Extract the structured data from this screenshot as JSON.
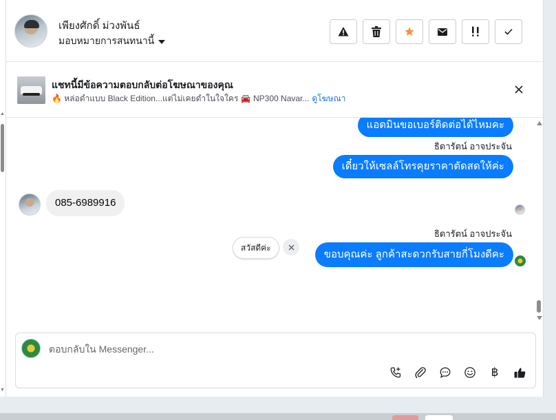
{
  "header": {
    "name": "เพียงศักดิ์ ม่วงพันธ์",
    "assign_label": "มอบหมายการสนทนานี้",
    "buttons": [
      {
        "name": "spam",
        "icon": "warning-icon"
      },
      {
        "name": "delete",
        "icon": "trash-icon"
      },
      {
        "name": "star",
        "icon": "star-icon",
        "color": "#f7923b"
      },
      {
        "name": "mark-unread",
        "icon": "envelope-icon"
      },
      {
        "name": "follow-up",
        "icon": "priority-icon"
      },
      {
        "name": "done",
        "icon": "check-icon"
      }
    ]
  },
  "ad": {
    "title": "แชทนี้มีข้อความตอบกลับต่อโฆษณาของคุณ",
    "subtitle_part1": "🔥 หล่อดำแบบ Black Edition...แต่ไม่เคยดำในใจใคร 🚘 NP300 Navar...",
    "link": "ดูโฆษณา"
  },
  "messages": {
    "out1": "แอดมินขอเบอร์ติดต่อได้ไหมคะ",
    "sender1": "ธิดารัตน์ อาจประจัน",
    "out2": "เดี๋ยวให้เซลล์โทรคุยราคาตัดสดให้ค่ะ",
    "in1": "085-6989916",
    "sender2": "ธิดารัตน์ อาจประจัน",
    "out3": "ขอบคุณค่ะ ลูกค้าสะดวกรับสายกี่โมงดีคะ",
    "quick_reply": "สวัสดีค่ะ"
  },
  "composer": {
    "placeholder": "ตอบกลับใน Messenger...",
    "tools": [
      "call-add-icon",
      "paperclip-icon",
      "chat-bubble-icon",
      "emoji-icon",
      "baht-icon",
      "thumbs-up-icon"
    ],
    "baht_symbol": "฿"
  },
  "colors": {
    "accent": "#0a7cff",
    "link": "#1b74e4",
    "star": "#f7923b"
  }
}
